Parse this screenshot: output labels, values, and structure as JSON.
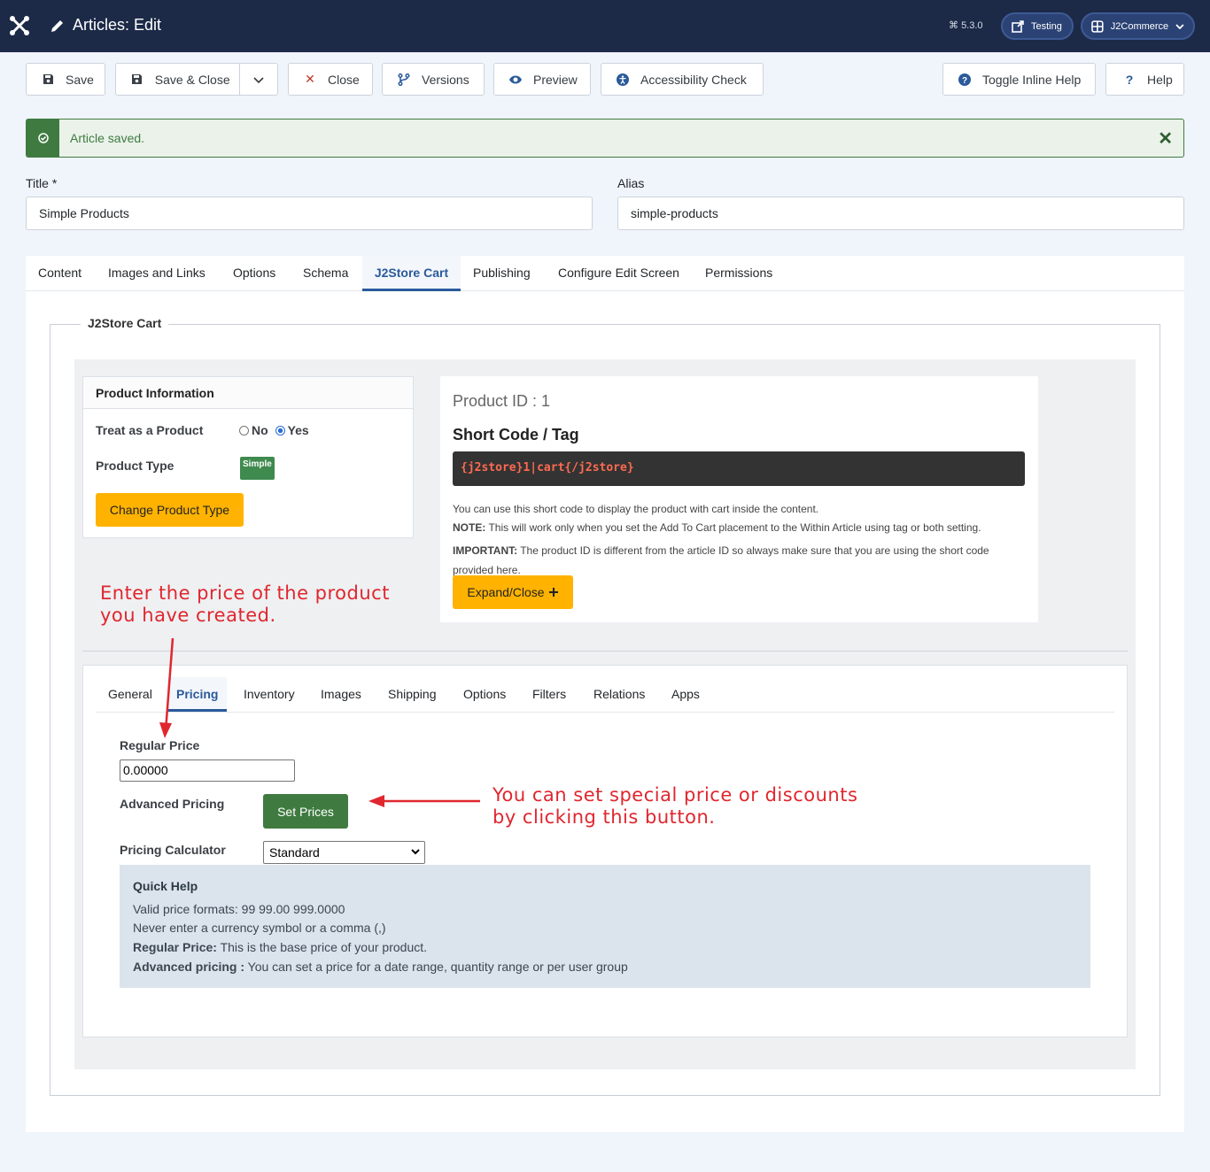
{
  "header": {
    "title": "Articles: Edit",
    "version": "5.3.0",
    "site_button": "Testing",
    "user_menu": "J2Commerce"
  },
  "toolbar": {
    "save": "Save",
    "save_close": "Save & Close",
    "close": "Close",
    "versions": "Versions",
    "preview": "Preview",
    "accessibility": "Accessibility Check",
    "toggle_help": "Toggle Inline Help",
    "help": "Help"
  },
  "alert": {
    "message": "Article saved."
  },
  "form": {
    "title_label": "Title *",
    "title_value": "Simple Products",
    "alias_label": "Alias",
    "alias_value": "simple-products"
  },
  "tabs": [
    "Content",
    "Images and Links",
    "Options",
    "Schema",
    "J2Store Cart",
    "Publishing",
    "Configure Edit Screen",
    "Permissions"
  ],
  "active_tab": "J2Store Cart",
  "j2store": {
    "legend": "J2Store Cart",
    "product_info_title": "Product Information",
    "treat_label": "Treat as a Product",
    "option_no": "No",
    "option_yes": "Yes",
    "selected_option": "Yes",
    "product_type_label": "Product Type",
    "product_type_badge": "Simple",
    "change_type_button": "Change Product Type",
    "product_id": "Product ID : 1",
    "shortcode_title": "Short Code / Tag",
    "shortcode": "{j2store}1|cart{/j2store}",
    "note_line1": "You can use this short code to display the product with cart inside the content.",
    "note_label": "NOTE:",
    "note_text": " This will work only when you set the Add To Cart placement to the Within Article using tag or both setting.",
    "important_label": "IMPORTANT:",
    "important_text": " The product ID is different from the article ID so always make sure that you are using the short code provided here.",
    "expand_button": "Expand/Close"
  },
  "annotations": {
    "price_note_line1": "Enter the price of the product",
    "price_note_line2": "you have created.",
    "button_note_line1": "You can set special price or discounts",
    "button_note_line2": "by clicking this button."
  },
  "sub_tabs": [
    "General",
    "Pricing",
    "Inventory",
    "Images",
    "Shipping",
    "Options",
    "Filters",
    "Relations",
    "Apps"
  ],
  "active_sub_tab": "Pricing",
  "pricing": {
    "regular_price_label": "Regular Price",
    "regular_price_value": "0.00000",
    "advanced_pricing_label": "Advanced Pricing",
    "set_prices_button": "Set Prices",
    "calculator_label": "Pricing Calculator",
    "calculator_value": "Standard"
  },
  "quick_help": {
    "title": "Quick Help",
    "line1": "Valid price formats: 99 99.00 999.0000",
    "line2": "Never enter a currency symbol or a comma (,)",
    "line3_label": "Regular Price:",
    "line3_text": " This is the base price of your product.",
    "line4_label": "Advanced pricing :",
    "line4_text": " You can set a price for a date range, quantity range or per user group"
  },
  "colors": {
    "header_bg": "#1c2a48",
    "accent": "#2a5a9a",
    "success": "#3f7b40",
    "warning_button": "#ffb300",
    "annotation": "#e0262e"
  },
  "icons": [
    "joomla-logo-icon",
    "pencil-icon",
    "save-icon",
    "chevron-down-icon",
    "close-x-icon",
    "branch-icon",
    "eye-icon",
    "accessibility-icon",
    "question-circle-icon",
    "question-icon",
    "external-link-icon",
    "user-menu-icon",
    "check-circle-icon",
    "plus-icon",
    "arrow-icon"
  ]
}
